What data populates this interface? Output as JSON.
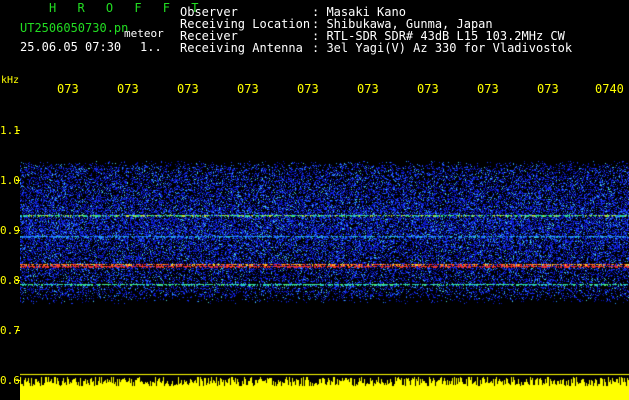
{
  "header": {
    "brand": "H R O F F T",
    "filename": "UT2506050730.pn",
    "tag": "meteor",
    "datetime": "25.06.05 07:30",
    "count": "1..",
    "info_labels": "Observer\nReceiving Location\nReceiver\nReceiving Antenna",
    "info_values": ": Masaki Kano\n: Shibukawa, Gunma, Japan\n: RTL-SDR SDR# 43dB L15 103.2MHz CW\n: 3el Yagi(V) Az 330 for Vladivostok"
  },
  "axis": {
    "unit": "kHz",
    "x_ticks": [
      "073",
      "073",
      "073",
      "073",
      "073",
      "073",
      "073",
      "073",
      "073",
      "0740"
    ],
    "y_ticks": [
      "1.1",
      "1.0",
      "0.9",
      "0.8",
      "0.7",
      "0.6"
    ]
  },
  "colors": {
    "header_green": "#22dd22",
    "axis_yellow": "#ffff00",
    "info_white": "#ffffff",
    "noise_blue": "#1a3cff",
    "band_red": "#ff2020"
  }
}
